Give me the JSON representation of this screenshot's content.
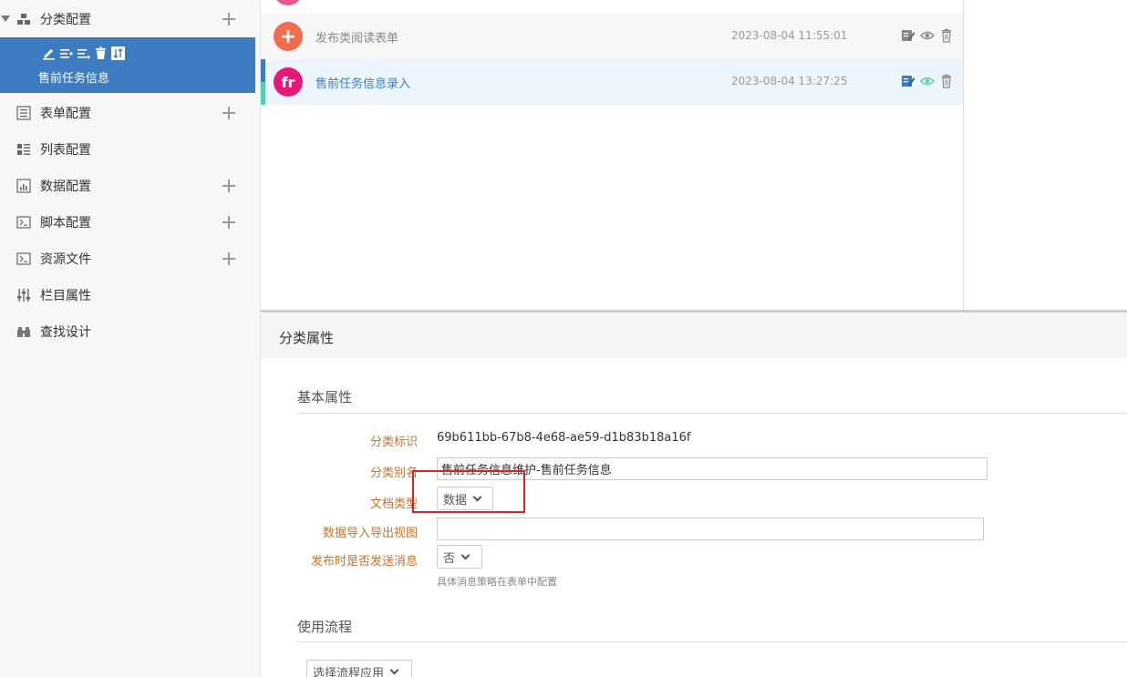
{
  "sidebar": {
    "category": {
      "label": "分类配置"
    },
    "selected": {
      "label": "售前任务信息"
    },
    "items": [
      {
        "label": "表单配置"
      },
      {
        "label": "列表配置"
      },
      {
        "label": "数据配置"
      },
      {
        "label": "脚本配置"
      },
      {
        "label": "资源文件"
      },
      {
        "label": "栏目属性"
      },
      {
        "label": "查找设计"
      }
    ]
  },
  "list": {
    "rows": [
      {
        "badge": "+",
        "name": "发布类阅读表单",
        "time": "2023-08-04 11:55:01",
        "badge_color": "#f26d4f"
      },
      {
        "badge": "fr",
        "name": "售前任务信息录入",
        "time": "2023-08-04 13:27:25",
        "badge_color": "#e8177a"
      }
    ]
  },
  "props": {
    "title": "分类属性",
    "basic": {
      "title": "基本属性",
      "id_label": "分类标识",
      "id_value": "69b611bb-67b8-4e68-ae59-d1b83b18a16f",
      "alias_label": "分类别名",
      "alias_value": "售前任务信息维护-售前任务信息",
      "doctype_label": "文档类型",
      "doctype_value": "数据",
      "view_label": "数据导入导出视图",
      "view_value": "",
      "notify_label": "发布时是否发送消息",
      "notify_value": "否",
      "notify_hint": "具体消息策略在表单中配置"
    },
    "flow": {
      "title": "使用流程",
      "select_value": "选择流程应用"
    }
  }
}
